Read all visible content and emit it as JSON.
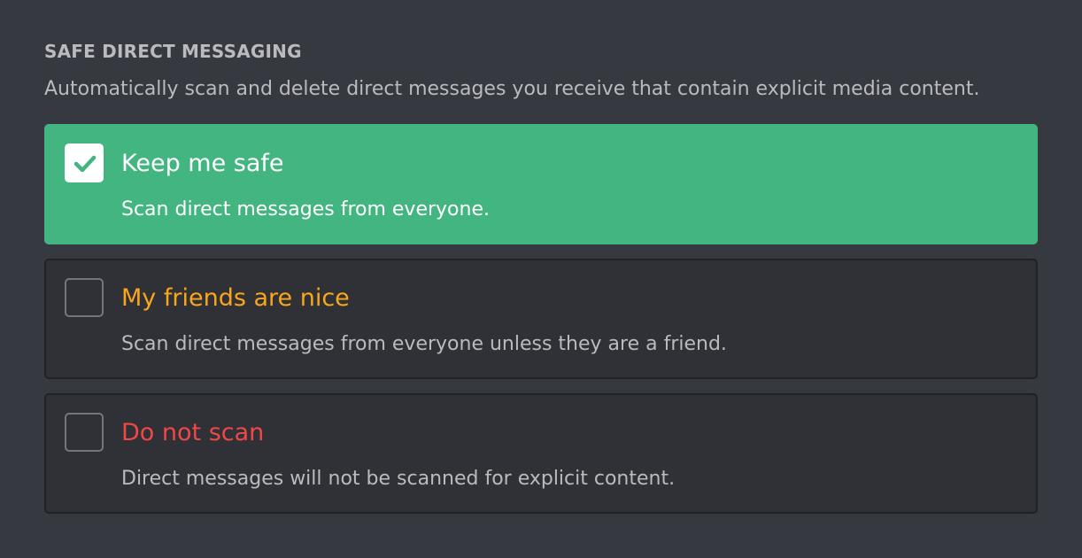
{
  "section": {
    "title": "SAFE DIRECT MESSAGING",
    "description": "Automatically scan and delete direct messages you receive that contain explicit media content."
  },
  "options": [
    {
      "label": "Keep me safe",
      "description": "Scan direct messages from everyone.",
      "checked": true,
      "label_color": "#ffffff"
    },
    {
      "label": "My friends are nice",
      "description": "Scan direct messages from everyone unless they are a friend.",
      "checked": false,
      "label_color": "#faa61a"
    },
    {
      "label": "Do not scan",
      "description": "Direct messages will not be scanned for explicit content.",
      "checked": false,
      "label_color": "#f04747"
    }
  ],
  "colors": {
    "background": "#36393f",
    "selected_background": "#43b581",
    "unselected_background": "#2f3136",
    "check_mark": "#43b581"
  },
  "icons": {
    "check": "check-icon"
  }
}
